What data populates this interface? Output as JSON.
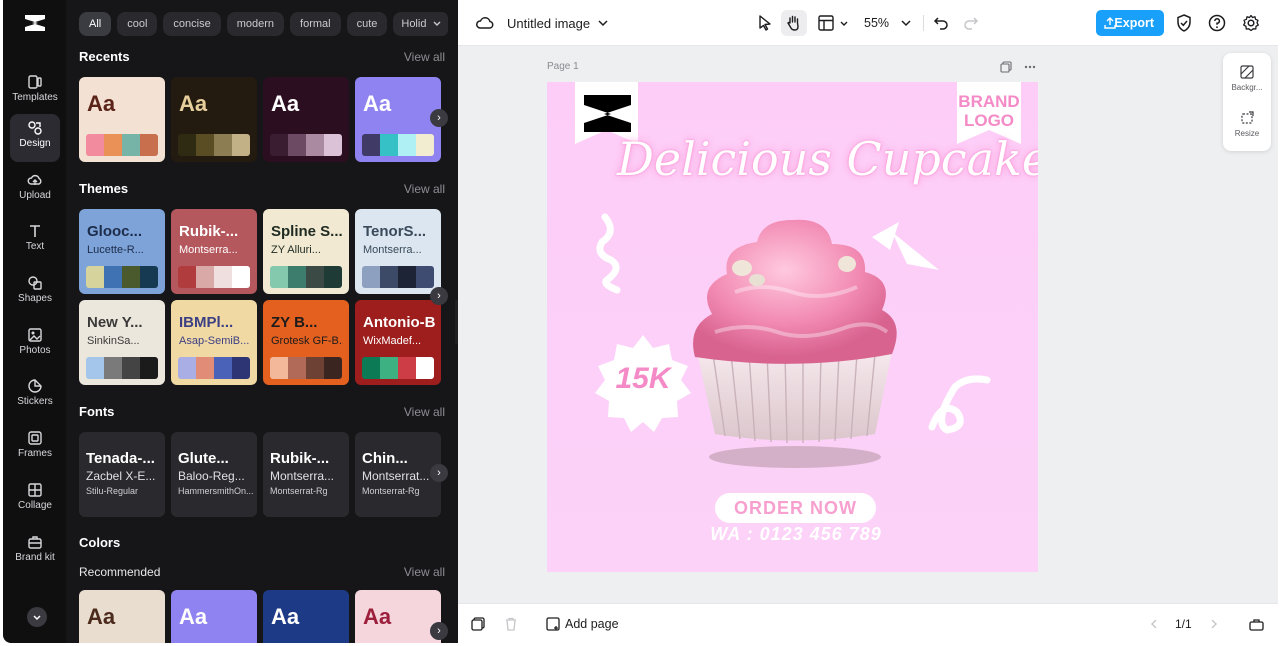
{
  "filters": [
    "All",
    "cool",
    "concise",
    "modern",
    "formal",
    "cute",
    "Holiday"
  ],
  "rail": {
    "items": [
      "Templates",
      "Design",
      "Upload",
      "Text",
      "Shapes",
      "Photos",
      "Stickers",
      "Frames",
      "Collage",
      "Brand kit"
    ]
  },
  "sections": {
    "recents": {
      "title": "Recents",
      "view_all": "View all"
    },
    "themes": {
      "title": "Themes",
      "view_all": "View all"
    },
    "fonts": {
      "title": "Fonts",
      "view_all": "View all"
    },
    "colors": {
      "title": "Colors"
    },
    "recommended": {
      "title": "Recommended",
      "view_all": "View all"
    }
  },
  "recents": [
    {
      "label": "Aa",
      "bg": "#f3e2d3",
      "fg": "#5a2418",
      "palette": [
        "#f28b9d",
        "#e99157",
        "#76b4a8",
        "#c8704e"
      ]
    },
    {
      "label": "Aa",
      "bg": "#231a10",
      "fg": "#e6cf9c",
      "palette": [
        "#2f2a12",
        "#5a4c23",
        "#8c7d52",
        "#c2b187"
      ]
    },
    {
      "label": "Aa",
      "bg": "#2b0f20",
      "fg": "#ffffff",
      "palette": [
        "#3a1d31",
        "#6d4a63",
        "#a98aa0",
        "#dcc2d7"
      ]
    },
    {
      "label": "Aa",
      "bg": "#8e83f0",
      "fg": "#ffffff",
      "palette": [
        "#3f3b66",
        "#36c1c7",
        "#aef0f4",
        "#f2ecd1"
      ]
    }
  ],
  "themes": [
    {
      "t1": "Glooc...",
      "t2": "Lucette-R...",
      "bg": "#7da3d9",
      "fg": "#1d2c4a",
      "palette": [
        "#d7d39c",
        "#3e72b3",
        "#4a5a2c",
        "#163a52"
      ]
    },
    {
      "t1": "Rubik-...",
      "t2": "Montserra...",
      "bg": "#b5585d",
      "fg": "#ffffff",
      "palette": [
        "#b13c3d",
        "#d8a9a6",
        "#efe0df",
        "#ffffff"
      ]
    },
    {
      "t1": "Spline S...",
      "t2": "ZY Alluri...",
      "bg": "#f1e9d2",
      "fg": "#1f2b22",
      "palette": [
        "#84c9ad",
        "#3c7d6d",
        "#3b4a45",
        "#1e3b35"
      ]
    },
    {
      "t1": "TenorS...",
      "t2": "Montserra...",
      "bg": "#dbe6f0",
      "fg": "#3a4a5a",
      "palette": [
        "#8ea0c0",
        "#3c4a68",
        "#1d2436",
        "#3f4c72"
      ]
    },
    {
      "t1": "New Y...",
      "t2": "SinkinSa...",
      "bg": "#ece7dc",
      "fg": "#3a3a3a",
      "palette": [
        "#a3c6ea",
        "#7a7a7a",
        "#444",
        "#1b1b1b"
      ]
    },
    {
      "t1": "IBMPl...",
      "t2": "Asap-SemiB...",
      "bg": "#f1d9a4",
      "fg": "#3b3f84",
      "palette": [
        "#a9aee4",
        "#e18c77",
        "#4a63b8",
        "#2e3575"
      ]
    },
    {
      "t1": "ZY B...",
      "t2": "Grotesk GF-B...",
      "bg": "#e4601f",
      "fg": "#1c1c1c",
      "palette": [
        "#f3b799",
        "#b26a58",
        "#6d4134",
        "#3a2520"
      ]
    },
    {
      "t1": "Antonio-Bold",
      "t2": "WixMadef...",
      "bg": "#9e1d1d",
      "fg": "#ffffff",
      "palette": [
        "#0c7a55",
        "#3db182",
        "#cc3d46",
        "#ffffff"
      ]
    }
  ],
  "fonts": [
    {
      "f1": "Tenada-...",
      "f2": "Zacbel X-E...",
      "f3": "Stilu-Regular"
    },
    {
      "f1": "Glute...",
      "f2": "Baloo-Reg...",
      "f3": "HammersmithOn..."
    },
    {
      "f1": "Rubik-...",
      "f2": "Montserra...",
      "f3": "Montserrat-Rg"
    },
    {
      "f1": "Chin...",
      "f2": "Montserrat...",
      "f3": "Montserrat-Rg"
    }
  ],
  "colors": [
    {
      "label": "Aa",
      "bg": "#e9ddd0",
      "fg": "#4b2a1c"
    },
    {
      "label": "Aa",
      "bg": "#8e83f0",
      "fg": "#ffffff"
    },
    {
      "label": "Aa",
      "bg": "#1c3a85",
      "fg": "#ffffff"
    },
    {
      "label": "Aa",
      "bg": "#f5d6dd",
      "fg": "#9c1f3c"
    }
  ],
  "topbar": {
    "title": "Untitled image",
    "zoom": "55%",
    "export": "Export"
  },
  "canvas": {
    "page_label": "Page 1",
    "headline": "Delicious Cupcake",
    "brand_line1": "BRAND",
    "brand_line2": "LOGO",
    "badge": "15K",
    "order": "ORDER NOW",
    "phone": "WA : 0123 456 789"
  },
  "side_panel": {
    "background": "Backgr...",
    "resize": "Resize"
  },
  "bottombar": {
    "add_page": "Add page",
    "page_count": "1/1"
  }
}
